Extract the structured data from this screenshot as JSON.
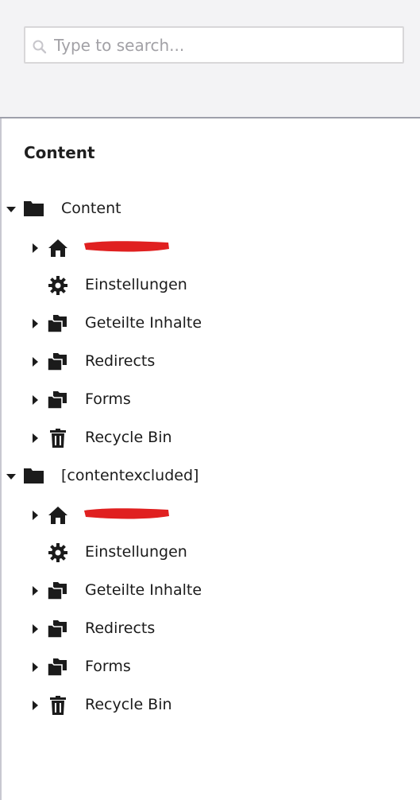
{
  "search": {
    "placeholder": "Type to search..."
  },
  "section": {
    "title": "Content"
  },
  "tree": {
    "root1": {
      "label": "Content",
      "children": {
        "home_redacted": "",
        "settings": "Einstellungen",
        "shared": "Geteilte Inhalte",
        "redirects": "Redirects",
        "forms": "Forms",
        "recycle": "Recycle Bin"
      }
    },
    "root2": {
      "label": "[contentexcluded]",
      "children": {
        "home_redacted": "",
        "settings": "Einstellungen",
        "shared": "Geteilte Inhalte",
        "redirects": "Redirects",
        "forms": "Forms",
        "recycle": "Recycle Bin"
      }
    }
  },
  "icons": {
    "folder": "folder-icon",
    "folders": "folders-icon",
    "home": "home-icon",
    "gear": "gear-icon",
    "trash": "trash-icon",
    "caret_down": "caret-down-icon",
    "caret_right": "caret-right-icon",
    "search": "search-icon"
  },
  "colors": {
    "panel_bg": "#f3f3f5",
    "text": "#1b1b1b",
    "placeholder": "#a2a1a6",
    "redaction": "#e02020"
  }
}
